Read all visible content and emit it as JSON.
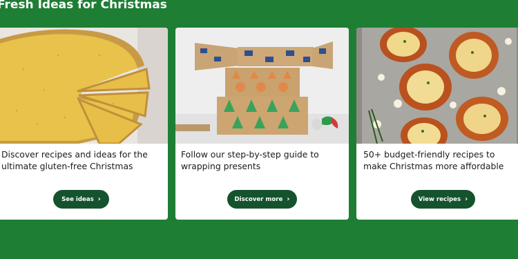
{
  "section": {
    "title": "Fresh Ideas for Christmas"
  },
  "cards": [
    {
      "image_alt": "Gluten-free tart with slices cut",
      "text": "Discover recipes and ideas for the ultimate gluten-free Christmas",
      "cta_label": "See ideas",
      "cta_icon": "chevron-right-icon"
    },
    {
      "image_alt": "Wrapped Christmas presents with cracker on top",
      "text": "Follow our step-by-step guide to wrapping presents",
      "cta_label": "Discover more",
      "cta_icon": "chevron-right-icon"
    },
    {
      "image_alt": "Baked stuffed squash halves on a tray",
      "text": "50+ budget-friendly recipes to make Christmas more affordable",
      "cta_label": "View recipes",
      "cta_icon": "chevron-right-icon"
    }
  ],
  "colors": {
    "background": "#1e7e34",
    "button": "#14532d",
    "card": "#ffffff"
  }
}
